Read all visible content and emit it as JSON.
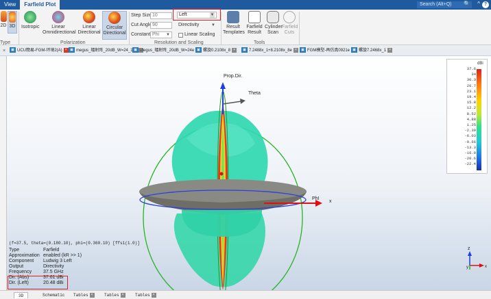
{
  "topbar": {
    "tabs": [
      "View",
      "Farfield Plot"
    ],
    "active_tab": "Farfield Plot",
    "search_placeholder": "Search (Alt+Q)"
  },
  "ribbon": {
    "left_cut": {
      "label_top": "2D",
      "label_3d": "3D"
    },
    "type_group_label": "Type",
    "polarization": {
      "buttons": [
        "Isotropic",
        "Linear Omnidirectional",
        "Linear Directional",
        "Circular Directional"
      ],
      "active": "Circular Directional",
      "group_label": "Polarization"
    },
    "resolution": {
      "step_size_label": "Step Size:",
      "step_size_value": "10",
      "cut_angle_label": "Cut Angle:",
      "cut_angle_value": "90",
      "constant_label": "Constant:",
      "constant_value": "Phi",
      "polarization_select": "Left",
      "quantity_select": "Directivity",
      "linear_scaling_label": "Linear Scaling",
      "group_label": "Resolution and Scaling"
    },
    "tools": {
      "buttons": [
        "Result Templates",
        "Farfield Result",
        "Cylinder Scan",
        "Farfield Cuts"
      ],
      "group_label": "Tools"
    }
  },
  "doc_tabs": [
    "UCU簡易-FGM-环境2(A)",
    "megus_辐射阵_20dB_W=24_18e",
    "megus_辐射阵_20dB_W=24e",
    "螺旋0.2108x_8",
    "7.2488x_1+8.2108x_8e",
    "FGM模型-再仿真0921e",
    "螺旋7.2468x_1"
  ],
  "plot": {
    "prop_dir_label": "Prop.Dir.",
    "theta_label": "Theta",
    "phi_label": "PhI",
    "x_axis_label": "x",
    "z_axis_label": "z",
    "y_axis_label": "y"
  },
  "legend": {
    "unit": "dBi",
    "ticks": [
      "37.6",
      "34",
      "30.3",
      "26.7",
      "23.1",
      "19.4",
      "15.8",
      "12.2",
      "8.52",
      "4.88",
      "1.25",
      "-2.39",
      "-6.03",
      "-9.66",
      "-13.3",
      "-16.9",
      "-20.6",
      "-22.4"
    ]
  },
  "info": {
    "header": "(f=37.5, theta=(0.180.10), phi=(0.360.10) [ffs1(1.0)]",
    "rows": [
      {
        "k": "Type",
        "v": "Farfield"
      },
      {
        "k": "Approximation",
        "v": "enabled (kR >> 1)"
      },
      {
        "k": "Component",
        "v": "Ludwig 3 Left"
      },
      {
        "k": "Output",
        "v": "Directivity"
      },
      {
        "k": "Frequency",
        "v": "37.5 GHz"
      },
      {
        "k": "Dir. (Abs)",
        "v": "37.61 dBi"
      },
      {
        "k": "Dir. (Left)",
        "v": "20.48 dBi"
      }
    ]
  },
  "bottom_tabs": [
    "3D",
    "Schematic",
    "Tables",
    "Tables",
    "Tables"
  ],
  "colors": {
    "accent": "#1f5a9e",
    "highlight": "#e02020"
  }
}
